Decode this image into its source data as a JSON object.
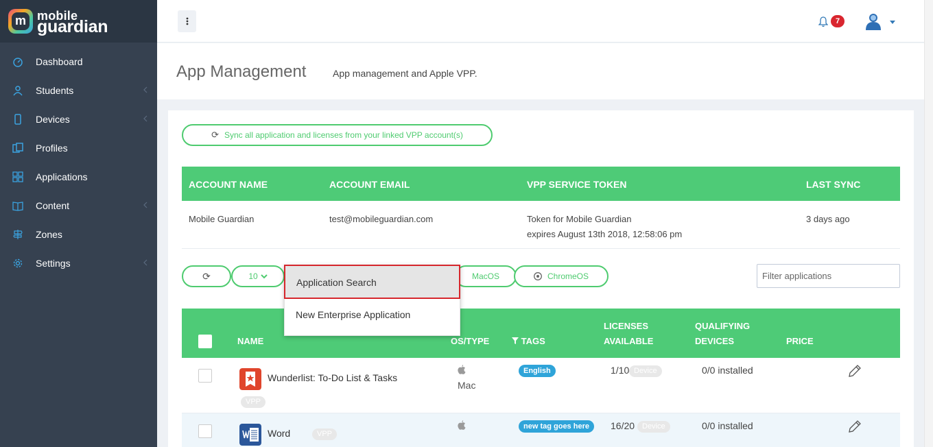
{
  "brand": {
    "line1": "mobile",
    "line2": "guardian"
  },
  "sidebar": {
    "items": [
      {
        "label": "Dashboard",
        "icon": "dashboard-icon",
        "has_children": false
      },
      {
        "label": "Students",
        "icon": "students-icon",
        "has_children": true
      },
      {
        "label": "Devices",
        "icon": "device-icon",
        "has_children": true
      },
      {
        "label": "Profiles",
        "icon": "profiles-icon",
        "has_children": false
      },
      {
        "label": "Applications",
        "icon": "applications-icon",
        "has_children": false
      },
      {
        "label": "Content",
        "icon": "book-icon",
        "has_children": true
      },
      {
        "label": "Zones",
        "icon": "signpost-icon",
        "has_children": false
      },
      {
        "label": "Settings",
        "icon": "gear-icon",
        "has_children": true
      }
    ]
  },
  "header": {
    "notification_count": "7"
  },
  "page": {
    "title": "App Management",
    "subtitle": "App management and Apple VPP."
  },
  "sync_button": {
    "label": "Sync all application and licenses from your linked VPP account(s)"
  },
  "accounts": {
    "columns": [
      "ACCOUNT NAME",
      "ACCOUNT EMAIL",
      "VPP SERVICE TOKEN",
      "LAST SYNC"
    ],
    "row": {
      "name": "Mobile Guardian",
      "email": "test@mobileguardian.com",
      "token_line1": "Token for Mobile Guardian",
      "token_line2": "expires August 13th 2018, 12:58:06 pm",
      "last_sync": "3 days ago"
    }
  },
  "controls": {
    "page_size": "10",
    "macos_label": "MacOS",
    "chromeos_label": "ChromeOS",
    "filter_placeholder": "Filter applications"
  },
  "dropdown": {
    "items": [
      "Application Search",
      "New Enterprise Application"
    ]
  },
  "apps": {
    "columns": {
      "name": "NAME",
      "os": "OS/TYPE",
      "tags": "TAGS",
      "licenses_l1": "LICENSES",
      "licenses_l2": "AVAILABLE",
      "qualifying_l1": "QUALIFYING",
      "qualifying_l2": "DEVICES",
      "price": "PRICE"
    },
    "rows": [
      {
        "name": "Wunderlist: To-Do List & Tasks",
        "badge": "VPP",
        "os": "Mac",
        "tag": "English",
        "licenses": "1/10",
        "license_type": "Device",
        "qualifying": "0/0 installed"
      },
      {
        "name": "Word",
        "badge": "VPP",
        "os": "",
        "tag": "new tag goes here",
        "licenses": "16/20",
        "license_type": "Device",
        "qualifying": "0/0 installed"
      }
    ]
  },
  "colors": {
    "sidebar": "#364150",
    "accent_green": "#4ecb77",
    "tag_blue": "#2fa4d9",
    "badge_red": "#d9262f"
  }
}
